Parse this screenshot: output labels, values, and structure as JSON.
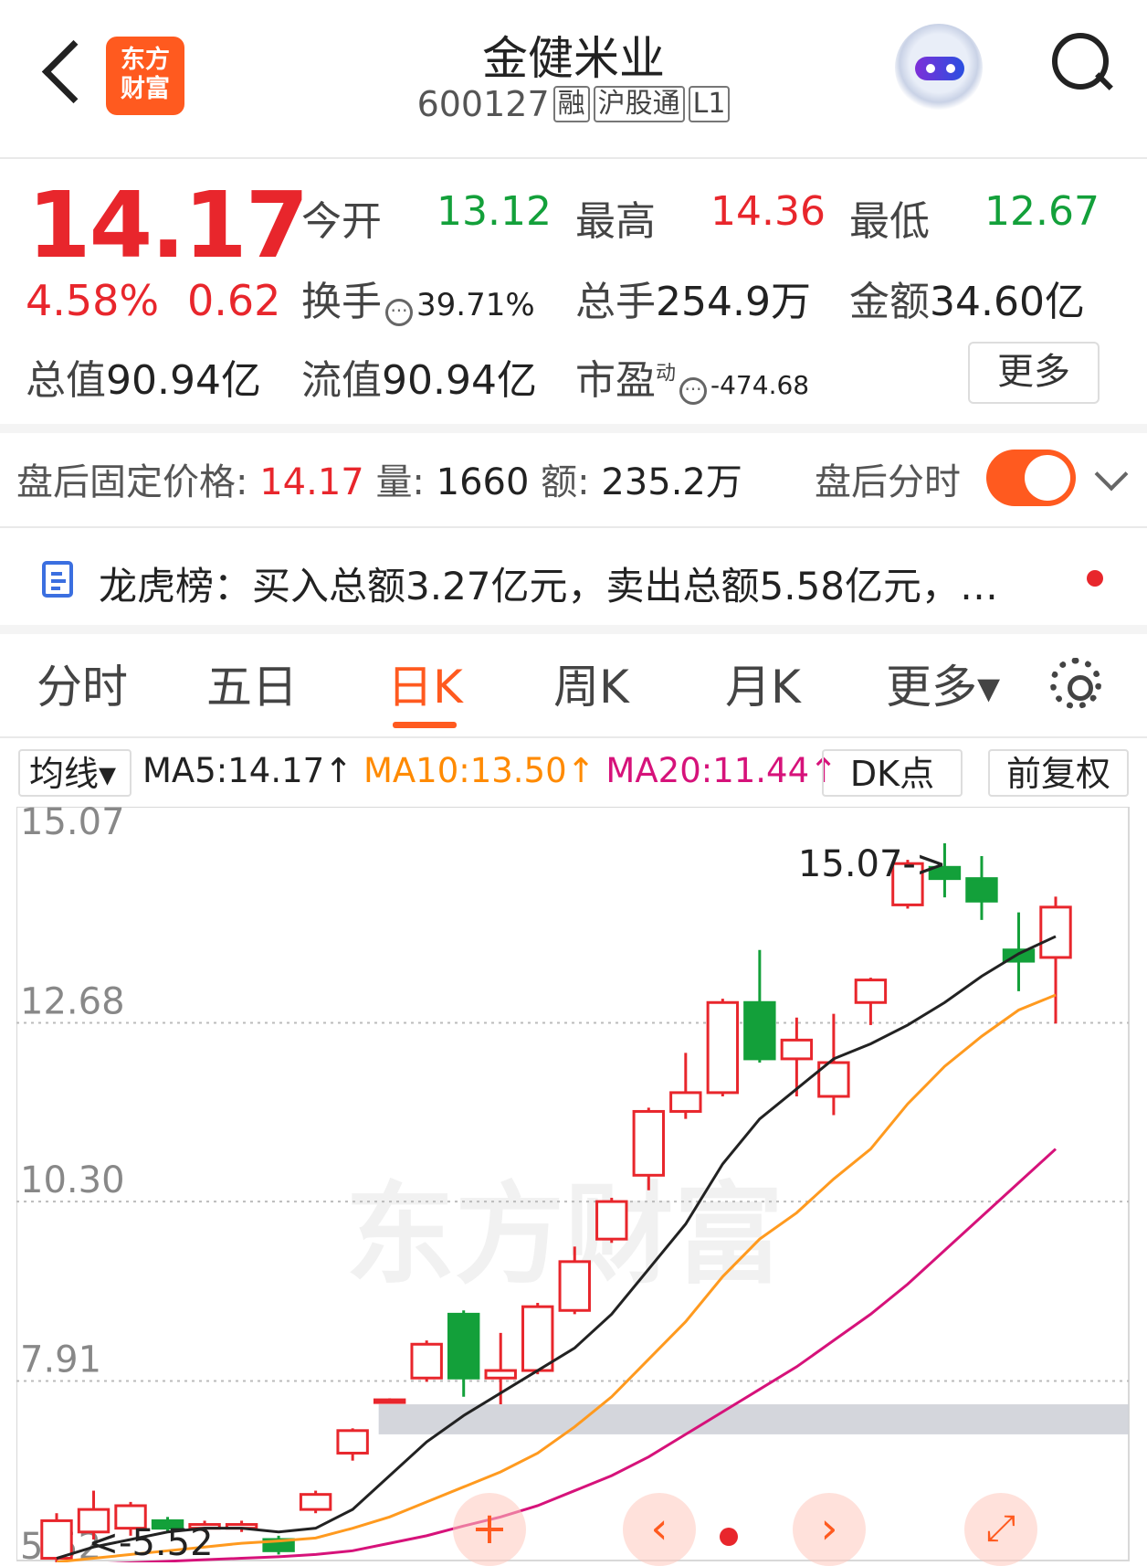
{
  "header": {
    "logo_line1": "东方",
    "logo_line2": "财富",
    "title": "金健米业",
    "code": "600127",
    "tags": [
      "融",
      "沪股通",
      "L1"
    ]
  },
  "quote": {
    "price": "14.17",
    "change_pct": "4.58%",
    "change_amt": "0.62",
    "open_label": "今开",
    "open": "13.12",
    "high_label": "最高",
    "high": "14.36",
    "low_label": "最低",
    "low": "12.67",
    "turnover_label": "换手",
    "turnover": "39.71%",
    "volume_label": "总手",
    "volume": "254.9万",
    "amount_label": "金额",
    "amount": "34.60亿",
    "mktcap_label": "总值",
    "mktcap": "90.94亿",
    "float_label": "流值",
    "float": "90.94亿",
    "pe_label": "市盈",
    "pe_sup": "动",
    "pe": "-474.68",
    "more": "更多"
  },
  "after_hours": {
    "label": "盘后固定价格:",
    "price": "14.17",
    "vol_label": "量:",
    "vol": "1660",
    "amt_label": "额:",
    "amt": "235.2万",
    "toggle_label": "盘后分时",
    "toggle_on": true
  },
  "news": {
    "text": "龙虎榜：买入总额3.27亿元，卖出总额5.58亿元，…"
  },
  "tabs": [
    "分时",
    "五日",
    "日K",
    "周K",
    "月K",
    "更多▾"
  ],
  "active_tab": "日K",
  "ma_row": {
    "selector": "均线▾",
    "ma5": "MA5:14.17↑",
    "ma10": "MA10:13.50↑",
    "ma20": "MA20:11.44↑",
    "dk": "DK点",
    "fq": "前复权"
  },
  "colors": {
    "up": "#e8262c",
    "down": "#13a03a",
    "accent": "#ff5a1f",
    "ma5": "#222222",
    "ma10": "#ff9a1f",
    "ma20": "#d6127a"
  },
  "chart_data": {
    "type": "candlestick",
    "y_ticks": [
      "15.07",
      "12.68",
      "10.30",
      "7.91",
      "5.52"
    ],
    "ylim": [
      5.52,
      15.07
    ],
    "annotation_high": "15.07->",
    "annotation_low": "<-5.52",
    "watermark": "东方财富",
    "candles": [
      {
        "o": 5.55,
        "c": 6.05,
        "h": 6.15,
        "l": 5.45
      },
      {
        "o": 5.9,
        "c": 6.2,
        "h": 6.45,
        "l": 5.8
      },
      {
        "o": 5.95,
        "c": 6.25,
        "h": 6.3,
        "l": 5.85
      },
      {
        "o": 6.05,
        "c": 5.95,
        "h": 6.1,
        "l": 5.9
      },
      {
        "o": 5.95,
        "c": 6.0,
        "h": 6.05,
        "l": 5.9
      },
      {
        "o": 5.95,
        "c": 6.0,
        "h": 6.05,
        "l": 5.9
      },
      {
        "o": 5.8,
        "c": 5.65,
        "h": 5.85,
        "l": 5.6
      },
      {
        "o": 6.2,
        "c": 6.4,
        "h": 6.45,
        "l": 6.15
      },
      {
        "o": 6.95,
        "c": 7.25,
        "h": 7.28,
        "l": 6.85
      },
      {
        "o": 7.66,
        "c": 7.66,
        "h": 7.68,
        "l": 7.64
      },
      {
        "o": 7.95,
        "c": 8.4,
        "h": 8.45,
        "l": 7.9
      },
      {
        "o": 8.8,
        "c": 7.95,
        "h": 8.85,
        "l": 7.7
      },
      {
        "o": 7.95,
        "c": 8.05,
        "h": 8.55,
        "l": 7.6
      },
      {
        "o": 8.05,
        "c": 8.9,
        "h": 8.95,
        "l": 8.0
      },
      {
        "o": 8.85,
        "c": 9.5,
        "h": 9.7,
        "l": 8.8
      },
      {
        "o": 9.8,
        "c": 10.3,
        "h": 10.35,
        "l": 9.75
      },
      {
        "o": 10.65,
        "c": 11.5,
        "h": 11.55,
        "l": 10.45
      },
      {
        "o": 11.5,
        "c": 11.75,
        "h": 12.28,
        "l": 11.4
      },
      {
        "o": 11.75,
        "c": 12.95,
        "h": 13.0,
        "l": 11.7
      },
      {
        "o": 12.95,
        "c": 12.2,
        "h": 13.65,
        "l": 12.15
      },
      {
        "o": 12.2,
        "c": 12.45,
        "h": 12.75,
        "l": 11.7
      },
      {
        "o": 11.7,
        "c": 12.15,
        "h": 12.8,
        "l": 11.45
      },
      {
        "o": 12.95,
        "c": 13.25,
        "h": 13.28,
        "l": 12.65
      },
      {
        "o": 14.25,
        "c": 14.8,
        "h": 14.85,
        "l": 14.2
      },
      {
        "o": 14.75,
        "c": 14.6,
        "h": 15.07,
        "l": 14.35
      },
      {
        "o": 14.6,
        "c": 14.3,
        "h": 14.9,
        "l": 14.05
      },
      {
        "o": 13.65,
        "c": 13.5,
        "h": 14.15,
        "l": 13.1
      },
      {
        "o": 13.55,
        "c": 14.22,
        "h": 14.36,
        "l": 12.67
      }
    ],
    "ma5": [
      5.55,
      5.7,
      5.8,
      5.9,
      5.95,
      5.95,
      5.9,
      5.95,
      6.2,
      6.65,
      7.1,
      7.45,
      7.75,
      8.05,
      8.35,
      8.8,
      9.4,
      10.0,
      10.8,
      11.4,
      11.8,
      12.2,
      12.4,
      12.65,
      12.95,
      13.3,
      13.6,
      13.83
    ],
    "ma10": [
      5.5,
      5.55,
      5.6,
      5.65,
      5.7,
      5.75,
      5.78,
      5.82,
      5.95,
      6.1,
      6.3,
      6.5,
      6.7,
      6.95,
      7.3,
      7.7,
      8.2,
      8.7,
      9.3,
      9.8,
      10.15,
      10.6,
      11.0,
      11.6,
      12.1,
      12.5,
      12.85,
      13.05
    ],
    "ma20": [
      5.45,
      5.47,
      5.49,
      5.51,
      5.53,
      5.55,
      5.57,
      5.6,
      5.65,
      5.75,
      5.85,
      5.98,
      6.1,
      6.25,
      6.45,
      6.65,
      6.9,
      7.2,
      7.5,
      7.8,
      8.1,
      8.45,
      8.8,
      9.2,
      9.65,
      10.1,
      10.55,
      11.0
    ],
    "support_band": [
      7.2,
      7.6
    ]
  }
}
